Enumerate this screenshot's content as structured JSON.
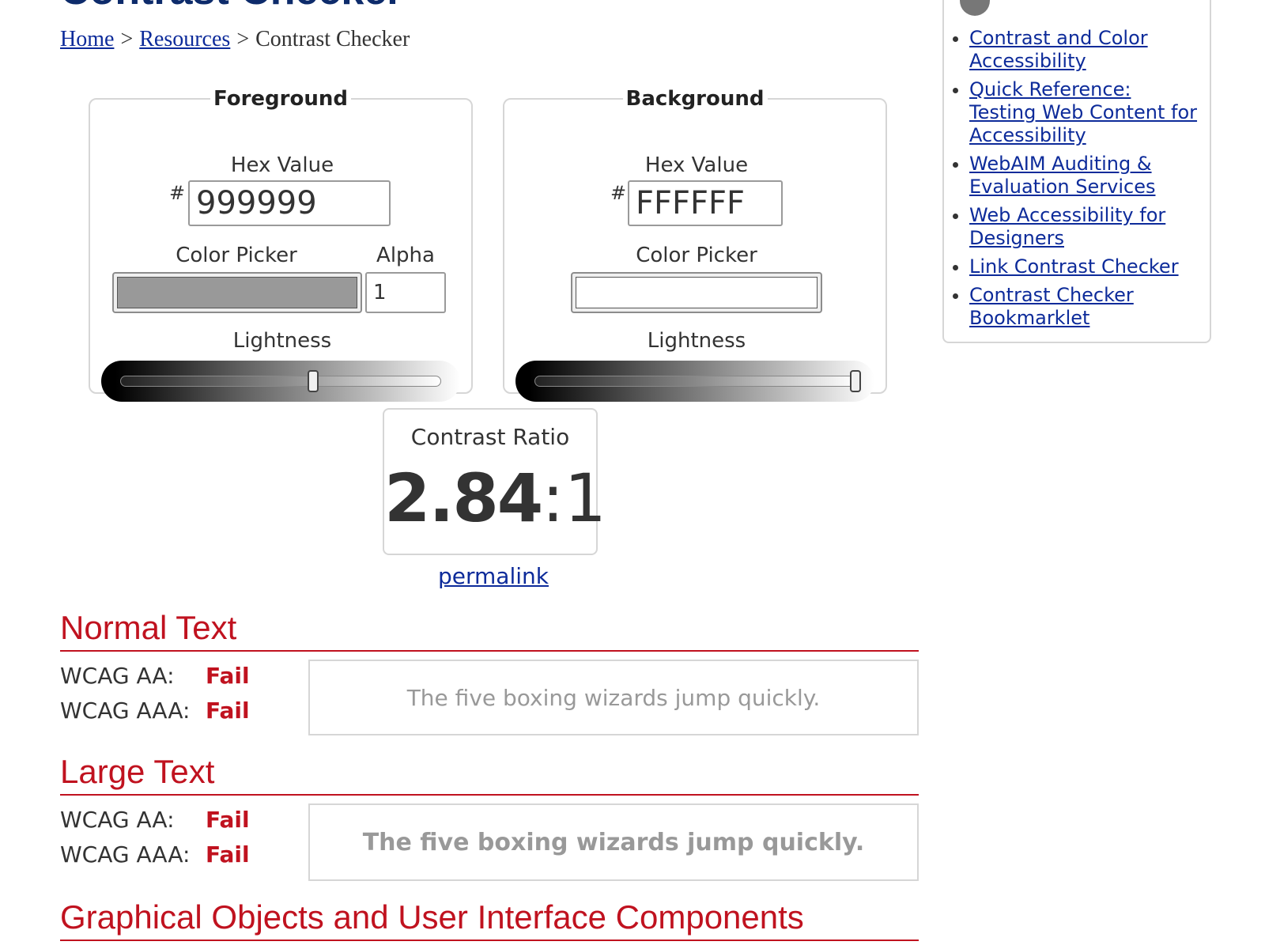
{
  "page": {
    "title": "Contrast Checker"
  },
  "breadcrumb": {
    "home": "Home",
    "sep1": ">",
    "resources": "Resources",
    "sep2": ">",
    "current": "Contrast Checker"
  },
  "foreground": {
    "legend": "Foreground",
    "hex_label": "Hex Value",
    "hash": "#",
    "hex_value": "999999",
    "picker_label": "Color Picker",
    "alpha_label": "Alpha",
    "alpha_value": "1",
    "lightness_label": "Lightness",
    "lightness_level": 0.6,
    "swatch_color": "#999999"
  },
  "background": {
    "legend": "Background",
    "hex_label": "Hex Value",
    "hash": "#",
    "hex_value": "FFFFFF",
    "picker_label": "Color Picker",
    "lightness_label": "Lightness",
    "lightness_level": 1.0,
    "swatch_color": "#FFFFFF"
  },
  "contrast": {
    "label": "Contrast Ratio",
    "ratio": "2.84",
    "colon": ":",
    "denominator": "1",
    "permalink": "permalink"
  },
  "normal_text": {
    "heading": "Normal Text",
    "aa_label": "WCAG AA:",
    "aa_result": "Fail",
    "aaa_label": "WCAG AAA:",
    "aaa_result": "Fail",
    "sample": "The five boxing wizards jump quickly."
  },
  "large_text": {
    "heading": "Large Text",
    "aa_label": "WCAG AA:",
    "aa_result": "Fail",
    "aaa_label": "WCAG AAA:",
    "aaa_result": "Fail",
    "sample": "The five boxing wizards jump quickly."
  },
  "graphical": {
    "heading": "Graphical Objects and User Interface Components"
  },
  "sidebar": {
    "icon": "shield-icon",
    "links": [
      "Contrast and Color Accessibility",
      "Quick Reference: Testing Web Content for Accessibility",
      "WebAIM Auditing & Evaluation Services",
      "Web Accessibility for Designers",
      "Link Contrast Checker",
      "Contrast Checker Bookmarklet"
    ]
  },
  "colors": {
    "heading_red": "#c0121f",
    "title_navy": "#0d2b6b",
    "link_blue": "#0d2b9a",
    "sample_text": "#999999"
  }
}
